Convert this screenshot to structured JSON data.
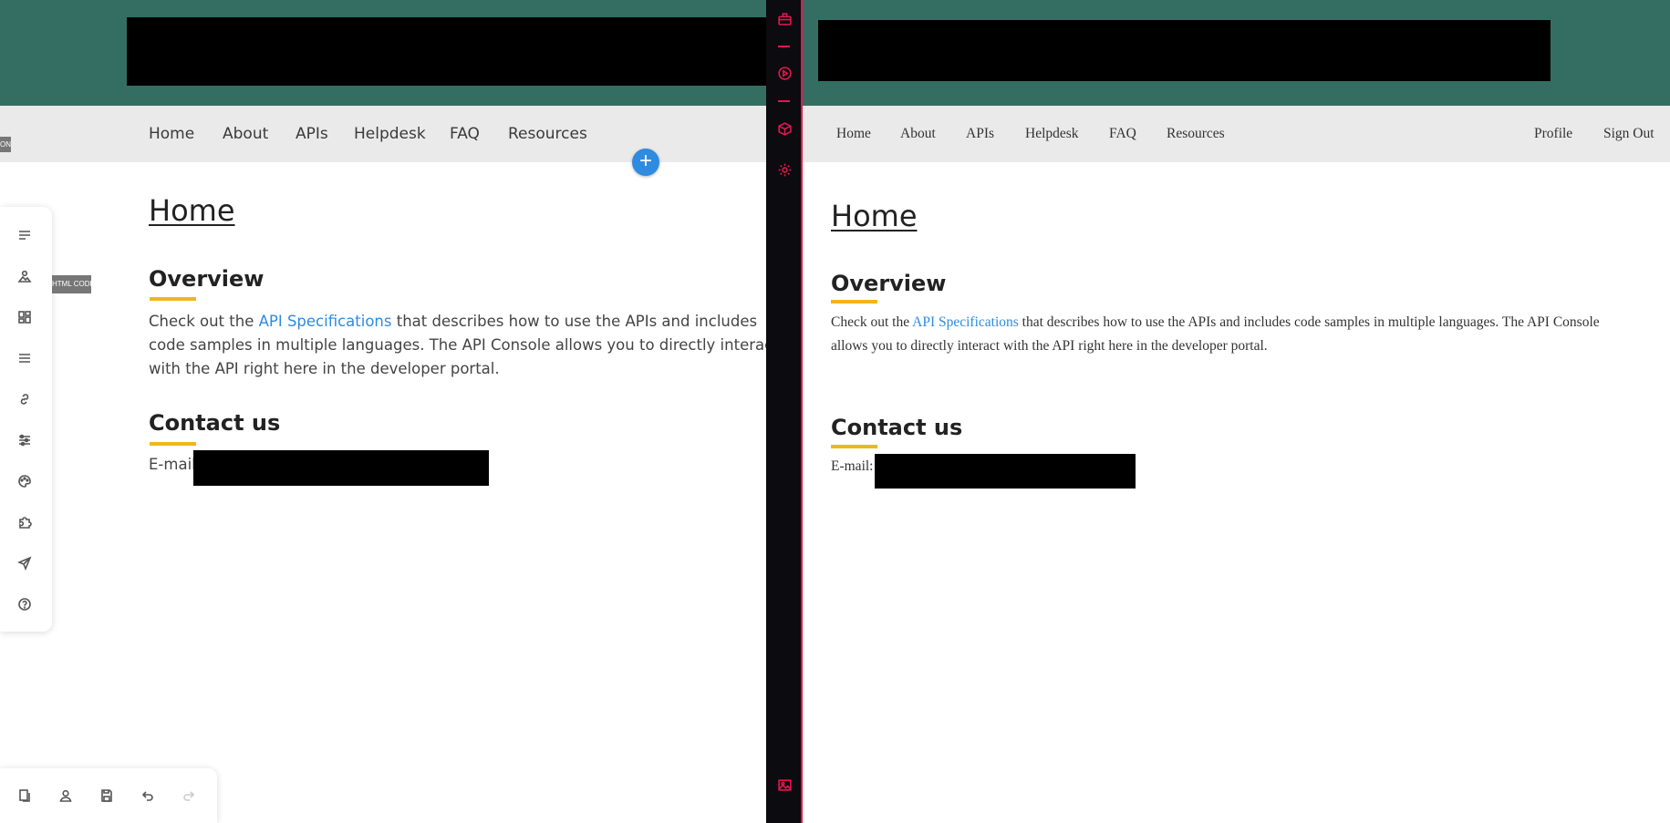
{
  "colors": {
    "banner": "#346e63",
    "nav_background": "#eaeaea",
    "link": "#2f8be0",
    "heading_underline_accent": "#f2b51c",
    "strip_background": "#0b0b10",
    "strip_accent": "#e2184f"
  },
  "editor": {
    "nav": [
      "Home",
      "About",
      "APIs",
      "Helpdesk",
      "FAQ",
      "Resources"
    ],
    "side_tag_label": "ON",
    "add_button_label": "+",
    "tooltip_html_code": "HTML CODE",
    "page_title": "Home",
    "overview_heading": "Overview",
    "overview_text_before": "Check out the ",
    "overview_link": "API Specifications",
    "overview_text_after": " that describes how to use the APIs and includes code samples in multiple languages. The API Console allows you to directly interact with the API right here in the developer portal.",
    "contact_heading": "Contact us",
    "email_label": "E-mail:",
    "side_tools": [
      "lines-icon",
      "image-icon",
      "layout-icon",
      "menu-icon",
      "link-icon",
      "sliders-icon",
      "palette-icon",
      "puzzle-icon",
      "send-icon",
      "help-icon"
    ],
    "bottom_tools": [
      "pages-icon",
      "user-icon",
      "save-icon",
      "undo-icon",
      "redo-icon"
    ]
  },
  "strip": {
    "icons": [
      "toolbox-icon",
      "play-icon",
      "cube-icon",
      "gear-icon",
      "image-icon"
    ]
  },
  "preview": {
    "nav": [
      "Home",
      "About",
      "APIs",
      "Helpdesk",
      "FAQ",
      "Resources"
    ],
    "nav_right": [
      "Profile",
      "Sign Out"
    ],
    "page_title": "Home",
    "overview_heading": "Overview",
    "overview_text_before": "Check out the ",
    "overview_link": "API Specifications",
    "overview_text_after": " that describes how to use the APIs and includes code samples in multiple languages. The API Console allows you to directly interact with the API right here in the developer portal.",
    "contact_heading": "Contact us",
    "email_label": "E-mail:"
  }
}
